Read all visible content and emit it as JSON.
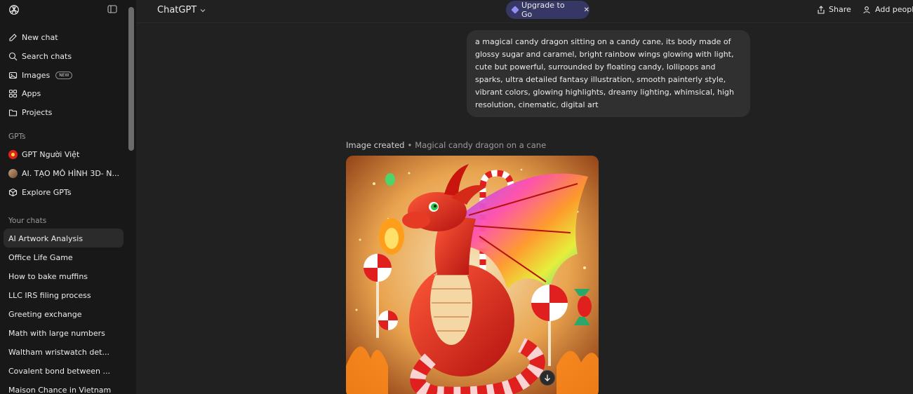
{
  "sidebar": {
    "nav": [
      {
        "label": "New chat",
        "icon": "edit-icon"
      },
      {
        "label": "Search chats",
        "icon": "search-icon"
      },
      {
        "label": "Images",
        "icon": "images-icon",
        "badge": "NEW"
      },
      {
        "label": "Apps",
        "icon": "apps-icon"
      },
      {
        "label": "Projects",
        "icon": "folder-icon"
      }
    ],
    "gpts_label": "GPTs",
    "gpts": [
      {
        "label": "GPT Người Việt"
      },
      {
        "label": "AI. TẠO MÔ HÌNH 3D- N..."
      },
      {
        "label": "Explore GPTs"
      }
    ],
    "chats_label": "Your chats",
    "chats": [
      "AI Artwork Analysis",
      "Office Life Game",
      "How to bake muffins",
      "LLC IRS filing process",
      "Greeting exchange",
      "Math with large numbers",
      "Waltham wristwatch det...",
      "Covalent bond between ...",
      "Maison Chance in Vietnam"
    ]
  },
  "header": {
    "model": "ChatGPT",
    "upgrade": "Upgrade to Go",
    "share": "Share",
    "add_people": "Add people"
  },
  "conversation": {
    "prompt": "a magical candy dragon sitting on a candy cane, its body made of glossy sugar and caramel, bright rainbow wings glowing with light, cute but powerful, surrounded by floating candy, lollipops and sparks, ultra detailed fantasy illustration, smooth painterly style, vibrant colors, glowing highlights, dreamy lighting, whimsical, high resolution, cinematic, digital art",
    "caption_prefix": "Image created",
    "caption_sep": "•",
    "caption_title": "Magical candy dragon on a cane"
  },
  "colors": {
    "background": "#212121",
    "sidebar": "#181818",
    "bubble": "#303030",
    "upgrade_pill": "#373766"
  }
}
